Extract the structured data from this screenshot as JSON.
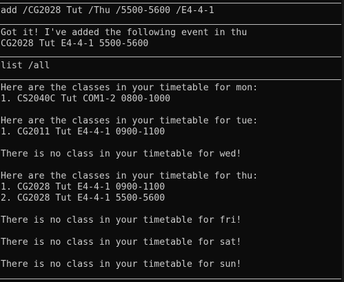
{
  "terminal": {
    "command1": "add /CG2028 Tut /Thu /5500-5600 /E4-4-1",
    "response1": [
      "Got it! I've added the following event in thu",
      "CG2028 Tut E4-4-1 5500-5600"
    ],
    "command2": "list /all",
    "response2": [
      "Here are the classes in your timetable for mon:",
      "1. CS2040C Tut COM1-2 0800-1000",
      "",
      "Here are the classes in your timetable for tue:",
      "1. CG2011 Tut E4-4-1 0900-1100",
      "",
      "There is no class in your timetable for wed!",
      "",
      "Here are the classes in your timetable for thu:",
      "1. CG2028 Tut E4-4-1 0900-1100",
      "2. CG2028 Tut E4-4-1 5500-5600",
      "",
      "There is no class in your timetable for fri!",
      "",
      "There is no class in your timetable for sat!",
      "",
      "There is no class in your timetable for sun!"
    ]
  }
}
